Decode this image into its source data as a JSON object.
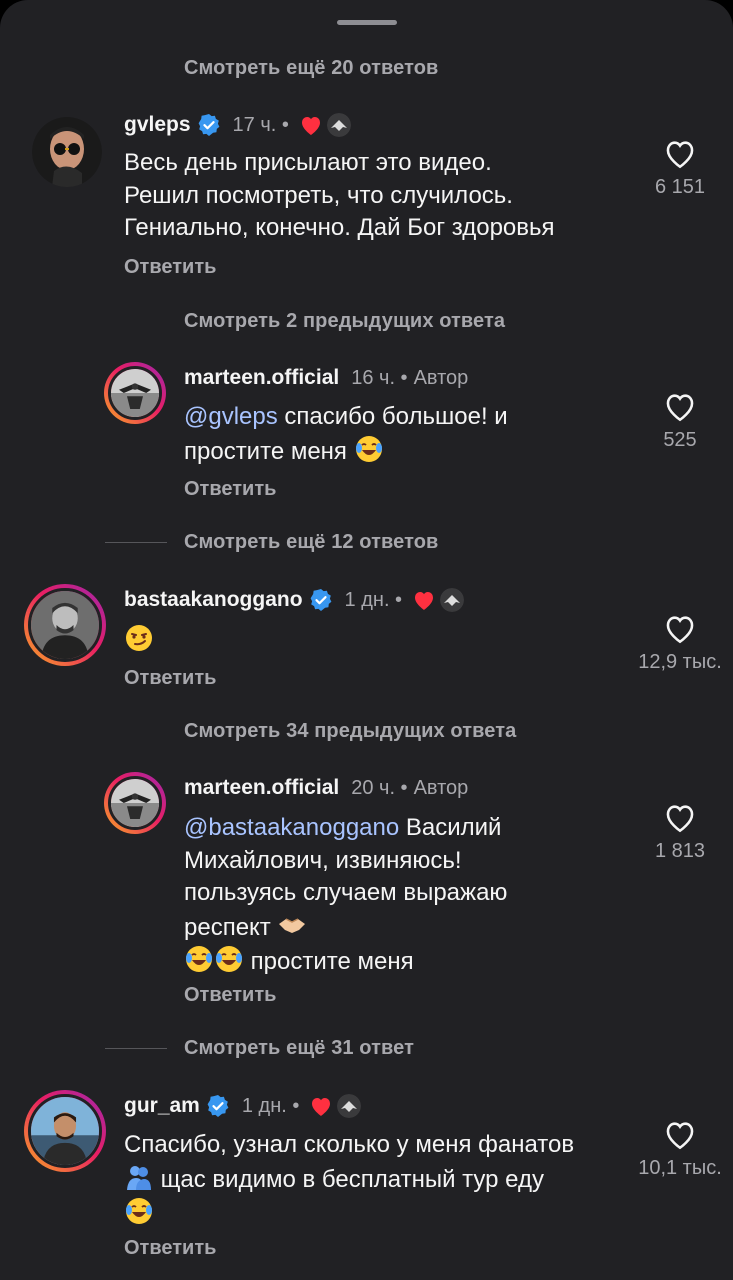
{
  "more_rows": [
    {
      "label": "Смотреть ещё 20 ответов"
    },
    {
      "label": "Смотреть 2 предыдущих ответа"
    },
    {
      "label": "Смотреть ещё 12 ответов"
    },
    {
      "label": "Смотреть 34 предыдущих ответа"
    },
    {
      "label": "Смотреть ещё 31 ответ"
    }
  ],
  "comments": [
    {
      "username": "gvleps",
      "verified": true,
      "time": "17 ч. •",
      "author_badge": "",
      "lines": [
        "Весь день присылают это видео.",
        "Решил посмотреть, что случилось.",
        "Гениально, конечно. Дай Бог здоровья"
      ],
      "reply_label": "Ответить",
      "likes": "6 151",
      "liked_by_creator": true
    },
    {
      "username": "marteen.official",
      "verified": false,
      "time": "16 ч. •",
      "author_badge": "Автор",
      "mention": "@gvleps",
      "lines": [
        " спасибо большое! и",
        "простите меня"
      ],
      "reply_label": "Ответить",
      "likes": "525"
    },
    {
      "username": "bastaakanoggano",
      "verified": true,
      "time": "1 дн. •",
      "author_badge": "",
      "lines": [],
      "emoji": "smirk-emoji",
      "reply_label": "Ответить",
      "likes": "12,9 тыс.",
      "liked_by_creator": true
    },
    {
      "username": "marteen.official",
      "verified": false,
      "time": "20 ч. •",
      "author_badge": "Автор",
      "mention": "@bastaakanoggano",
      "lines": [
        " Василий",
        "Михайлович, извиняюсь!",
        "пользуясь случаем выражаю",
        "респект",
        " простите меня"
      ],
      "reply_label": "Ответить",
      "likes": "1 813"
    },
    {
      "username": "gur_am",
      "verified": true,
      "time": "1 дн. •",
      "author_badge": "",
      "lines": [
        "Спасибо, узнал сколько у меня фанатов",
        " щас видимо в бесплатный тур еду"
      ],
      "reply_label": "Ответить",
      "likes": "10,1 тыс.",
      "liked_by_creator": true
    }
  ],
  "colors": {
    "background": "#212124",
    "muted": "#a8a8ad",
    "verified": "#3897f0",
    "heart": "#ff3040",
    "mention": "#a9c4ff"
  }
}
